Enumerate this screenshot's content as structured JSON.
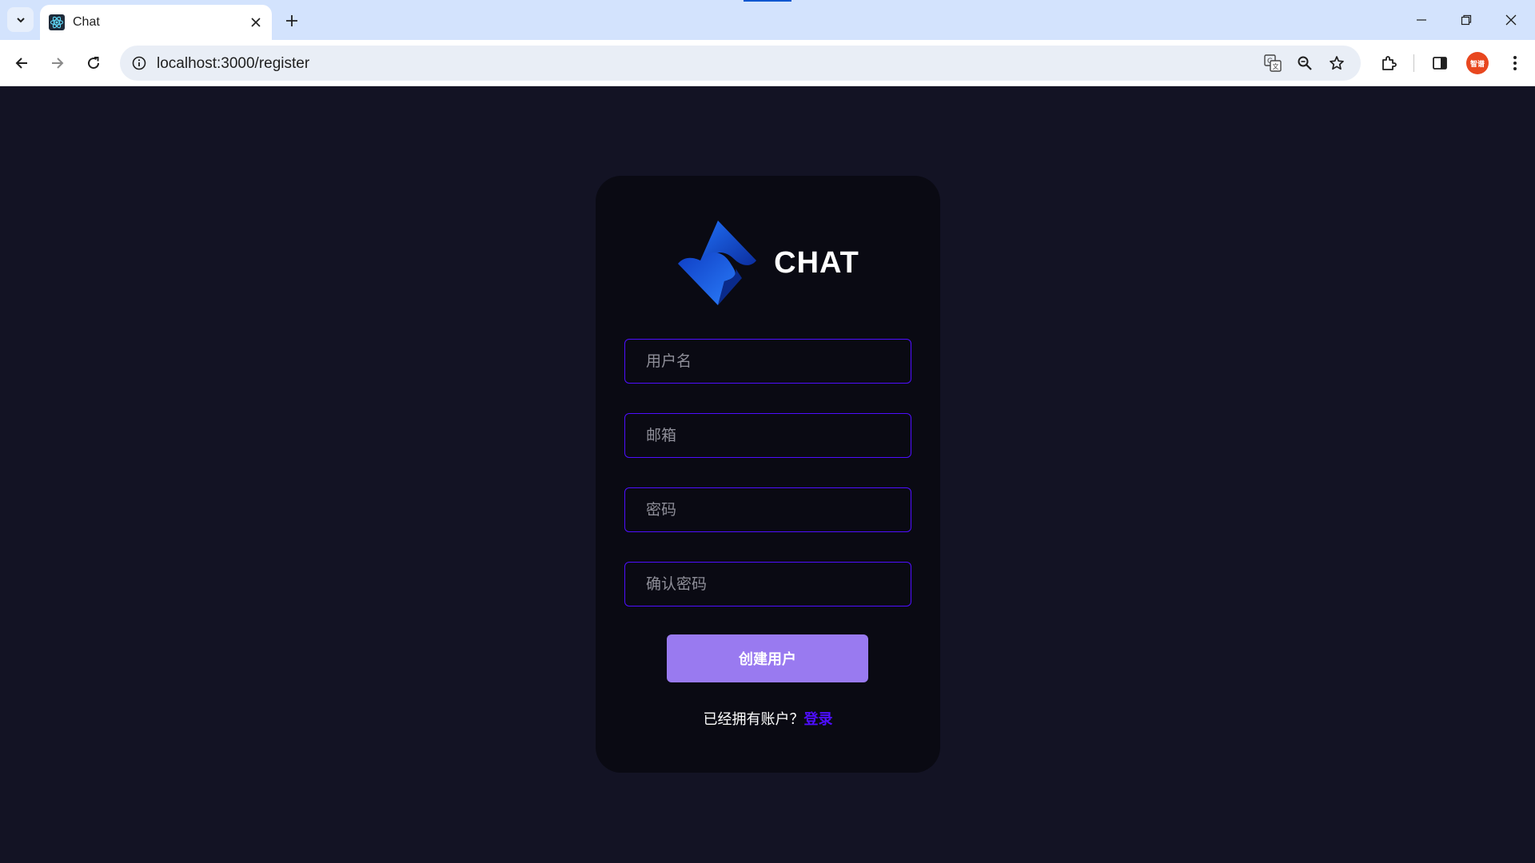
{
  "browser": {
    "tab_title": "Chat",
    "url": "localhost:3000/register",
    "profile_label": "智谱"
  },
  "brand": {
    "name": "CHAT"
  },
  "form": {
    "username_placeholder": "用户名",
    "email_placeholder": "邮箱",
    "password_placeholder": "密码",
    "confirm_placeholder": "确认密码",
    "submit_label": "创建用户",
    "have_account_text": "已经拥有账户？",
    "login_link": "登录"
  },
  "colors": {
    "page_bg": "#131324",
    "card_bg": "#0a0a13",
    "accent": "#4e0eff",
    "button": "#997af0"
  },
  "icons": [
    "tab-list-icon",
    "react-favicon-icon",
    "close-icon",
    "plus-icon",
    "minimize-icon",
    "restore-icon",
    "window-close-icon",
    "back-arrow-icon",
    "forward-arrow-icon",
    "reload-icon",
    "site-info-icon",
    "translate-icon",
    "zoom-icon",
    "star-icon",
    "extensions-icon",
    "side-panel-icon",
    "more-vert-icon"
  ]
}
